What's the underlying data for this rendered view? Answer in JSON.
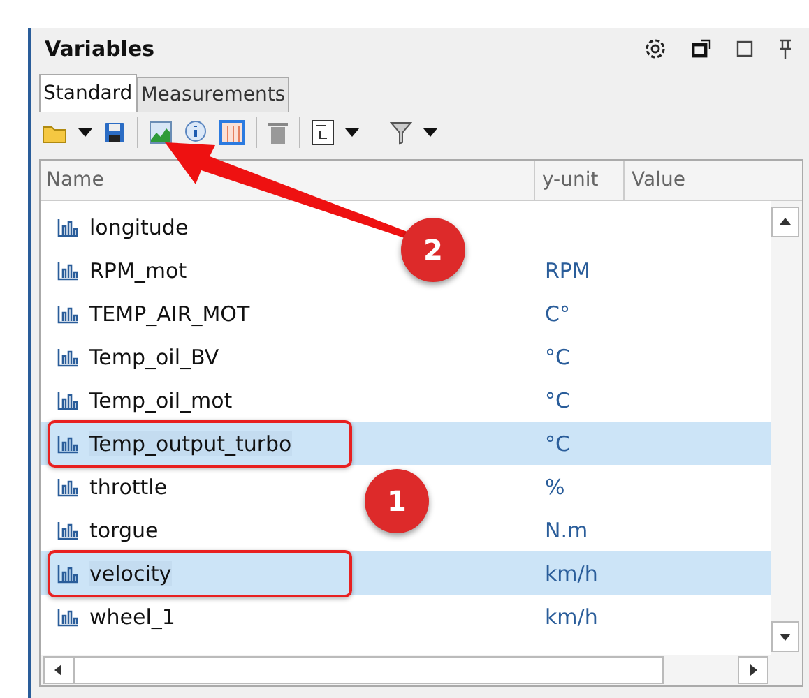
{
  "panel": {
    "title": "Variables"
  },
  "tabs": [
    {
      "label": "Standard",
      "selected": true
    },
    {
      "label": "Measurements",
      "selected": false
    }
  ],
  "table": {
    "columns": [
      "Name",
      "y-unit",
      "Value"
    ],
    "rows": [
      {
        "name": "longitude",
        "unit": "",
        "selected": false,
        "marked": false
      },
      {
        "name": "RPM_mot",
        "unit": "RPM",
        "selected": false,
        "marked": false
      },
      {
        "name": "TEMP_AIR_MOT",
        "unit": "C°",
        "selected": false,
        "marked": false
      },
      {
        "name": "Temp_oil_BV",
        "unit": "°C",
        "selected": false,
        "marked": false
      },
      {
        "name": "Temp_oil_mot",
        "unit": "°C",
        "selected": false,
        "marked": false
      },
      {
        "name": "Temp_output_turbo",
        "unit": "°C",
        "selected": true,
        "marked": true
      },
      {
        "name": "throttle",
        "unit": "%",
        "selected": false,
        "marked": false
      },
      {
        "name": "torgue",
        "unit": "N.m",
        "selected": false,
        "marked": false
      },
      {
        "name": "velocity",
        "unit": "km/h",
        "selected": true,
        "marked": true
      },
      {
        "name": "wheel_1",
        "unit": "km/h",
        "selected": false,
        "marked": false
      }
    ]
  },
  "callouts": [
    "2",
    "1"
  ]
}
